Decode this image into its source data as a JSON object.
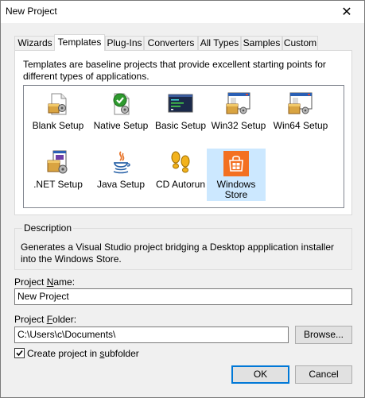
{
  "window": {
    "title": "New Project",
    "close_glyph": "✕"
  },
  "tabs": [
    {
      "label": "Wizards",
      "active": false
    },
    {
      "label": "Templates",
      "active": true
    },
    {
      "label": "Plug-Ins",
      "active": false
    },
    {
      "label": "Converters",
      "active": false
    },
    {
      "label": "All Types",
      "active": false
    },
    {
      "label": "Samples",
      "active": false
    },
    {
      "label": "Custom",
      "active": false
    }
  ],
  "templates_panel": {
    "description": "Templates are baseline projects that provide excellent starting points for different types of applications.",
    "items": [
      {
        "label": "Blank Setup",
        "icon": "blank-setup-icon",
        "selected": false
      },
      {
        "label": "Native Setup",
        "icon": "native-setup-icon",
        "selected": false
      },
      {
        "label": "Basic Setup",
        "icon": "basic-setup-icon",
        "selected": false
      },
      {
        "label": "Win32 Setup",
        "icon": "win32-setup-icon",
        "selected": false
      },
      {
        "label": "Win64 Setup",
        "icon": "win64-setup-icon",
        "selected": false
      },
      {
        "label": ".NET Setup",
        "icon": "dotnet-setup-icon",
        "selected": false
      },
      {
        "label": "Java Setup",
        "icon": "java-setup-icon",
        "selected": false
      },
      {
        "label": "CD Autorun",
        "icon": "cd-autorun-icon",
        "selected": false
      },
      {
        "label": "Windows Store",
        "icon": "windows-store-icon",
        "selected": true
      }
    ]
  },
  "description_group": {
    "legend": "Description",
    "text": "Generates a Visual Studio project bridging a Desktop appplication installer into the Windows Store."
  },
  "project_name": {
    "label_pre": "Project ",
    "label_accel": "N",
    "label_post": "ame:",
    "value": "New Project"
  },
  "project_folder": {
    "label_pre": "Project ",
    "label_accel": "F",
    "label_post": "older:",
    "value": "C:\\Users\\c\\Documents\\",
    "browse_label": "Browse..."
  },
  "subfolder_option": {
    "label_pre": "Create project in ",
    "label_accel": "s",
    "label_post": "ubfolder",
    "checked": true
  },
  "buttons": {
    "ok": "OK",
    "cancel": "Cancel"
  },
  "colors": {
    "selection": "#cce8ff",
    "accent": "#0078d7",
    "dialog_bg": "#f0f0f0"
  }
}
